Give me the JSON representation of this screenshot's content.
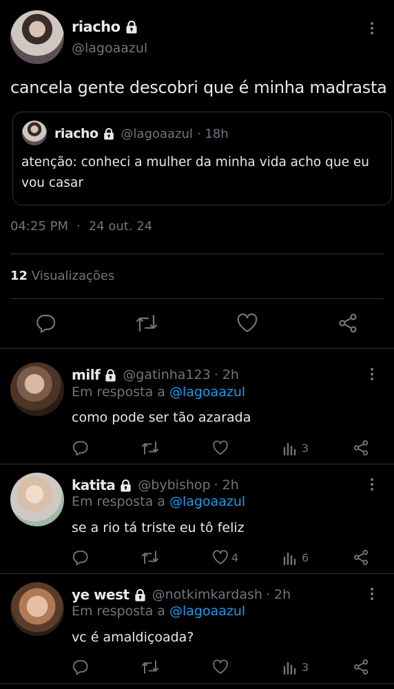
{
  "main_tweet": {
    "display_name": "riacho",
    "handle": "@lagoaazul",
    "text": "cancela gente descobri que é minha madrasta",
    "quote": {
      "display_name": "riacho",
      "handle": "@lagoaazul",
      "time": "· 18h",
      "text": "atenção: conheci a mulher da minha vida acho que eu vou casar"
    },
    "time": "04:25 PM",
    "separator": "·",
    "date": "24 out. 24",
    "views_count": "12",
    "views_label": "Visualizações"
  },
  "replies": [
    {
      "display_name": "milf",
      "handle": "@gatinha123",
      "time": "· 2h",
      "reply_prefix": "Em resposta a",
      "reply_to": "@lagoaazul",
      "text": "como pode ser tão azarada",
      "like_count": "",
      "views_count": "3"
    },
    {
      "display_name": "katita",
      "handle": "@bybishop",
      "time": "· 2h",
      "reply_prefix": "Em resposta a",
      "reply_to": "@lagoaazul",
      "text": "se a rio tá triste eu tô feliz",
      "like_count": "4",
      "views_count": "6"
    },
    {
      "display_name": "ye west",
      "handle": "@notkimkardash",
      "time": "· 2h",
      "reply_prefix": "Em resposta a",
      "reply_to": "@lagoaazul",
      "text": "vc é amaldiçoada?",
      "like_count": "",
      "views_count": "3"
    }
  ],
  "icons": [
    "lock-icon",
    "more-icon",
    "reply-icon",
    "retweet-icon",
    "like-icon",
    "share-icon",
    "views-icon"
  ],
  "colors": {
    "background": "#000000",
    "text": "#e7e9ea",
    "secondary": "#71767b",
    "link": "#1d9bf0",
    "border": "#2f3336"
  }
}
